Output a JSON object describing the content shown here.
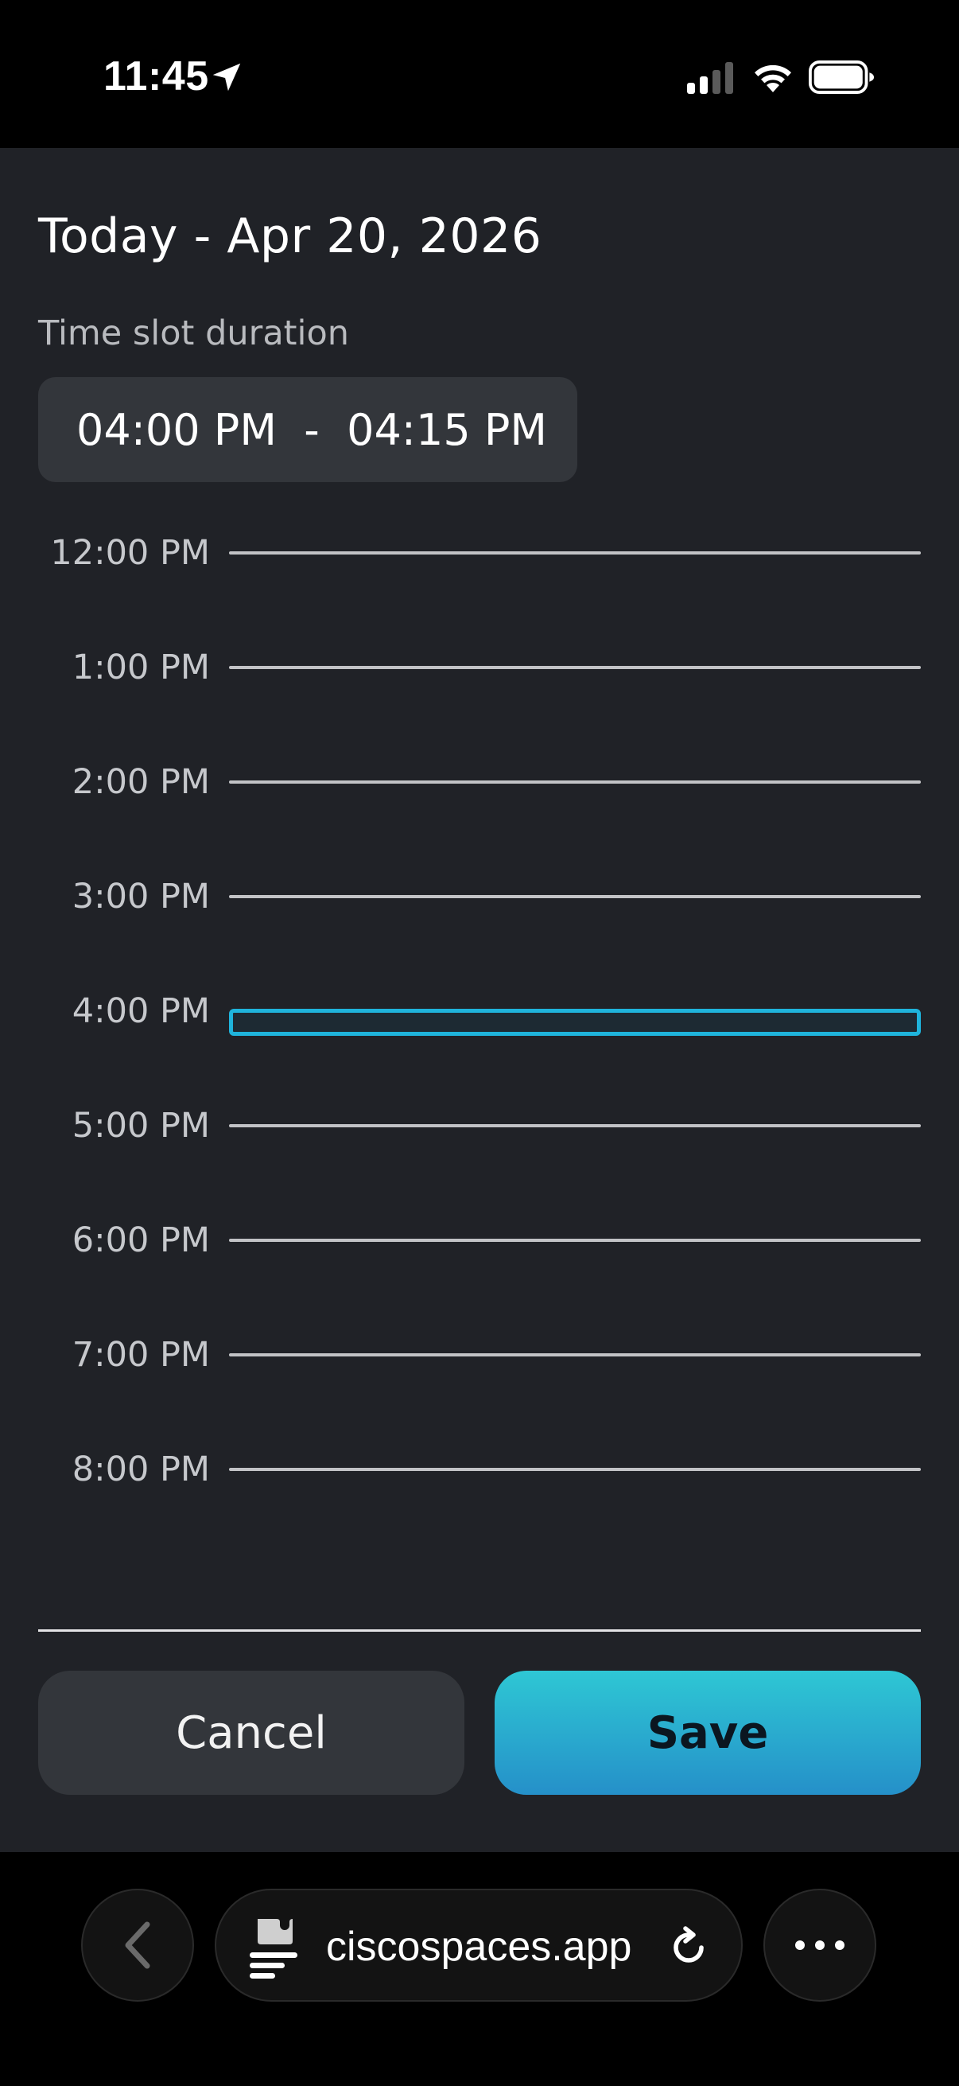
{
  "status_bar": {
    "time": "11:45",
    "icons": [
      "location-arrow-icon",
      "cellular-signal-icon",
      "wifi-icon",
      "battery-icon"
    ]
  },
  "sheet": {
    "date_title": "Today - Apr 20, 2026",
    "slot_label": "Time slot duration",
    "time_range": "04:00 PM  -  04:15 PM",
    "hours": [
      "12:00 PM",
      "1:00 PM",
      "2:00 PM",
      "3:00 PM",
      "4:00 PM",
      "5:00 PM",
      "6:00 PM",
      "7:00 PM",
      "8:00 PM"
    ],
    "selected_hour": "4:00 PM",
    "cancel_label": "Cancel",
    "save_label": "Save"
  },
  "browser": {
    "url": "ciscospaces.app",
    "icons": [
      "back-chevron-icon",
      "page-icon",
      "reload-icon",
      "more-icon"
    ]
  },
  "colors": {
    "sheet_bg": "#202227",
    "accent": "#1fb4dc",
    "save_gradient_top": "#2ec7d4",
    "save_gradient_bottom": "#2590c9"
  }
}
